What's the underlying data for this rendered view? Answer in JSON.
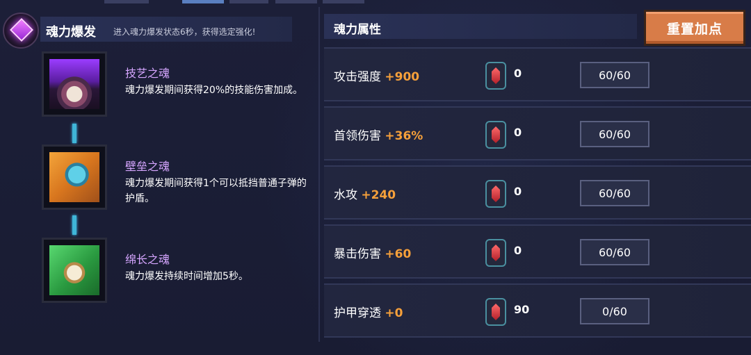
{
  "burst": {
    "title": "魂力爆发",
    "description": "进入魂力爆发状态6秒，获得选定强化!"
  },
  "souls": [
    {
      "name": "技艺之魂",
      "description": "魂力爆发期间获得20%的技能伤害加成。",
      "icon": "purple-flame-orb-icon",
      "color": "#b64aff"
    },
    {
      "name": "壁垒之魂",
      "description": "魂力爆发期间获得1个可以抵挡普通子弹的护盾。",
      "icon": "shield-sword-icon",
      "color": "#e8851e"
    },
    {
      "name": "绵长之魂",
      "description": "魂力爆发持续时间增加5秒。",
      "icon": "stopwatch-icon",
      "color": "#2fb24a"
    }
  ],
  "attributes": {
    "title": "魂力属性",
    "reset_label": "重置加点",
    "rows": [
      {
        "label": "攻击强度",
        "bonus": "+900",
        "gem_count": "0",
        "level": "60/60"
      },
      {
        "label": "首领伤害",
        "bonus": "+36%",
        "gem_count": "0",
        "level": "60/60"
      },
      {
        "label": "水攻",
        "bonus": "+240",
        "gem_count": "0",
        "level": "60/60"
      },
      {
        "label": "暴击伤害",
        "bonus": "+60",
        "gem_count": "0",
        "level": "60/60"
      },
      {
        "label": "护甲穿透",
        "bonus": "+0",
        "gem_count": "90",
        "level": "0/60"
      }
    ]
  },
  "colors": {
    "accent_orange": "#d87c48",
    "bonus_orange": "#f6a03a",
    "soul_name_purple": "#d6a6ff",
    "connector_cyan": "#3fb6d8"
  }
}
